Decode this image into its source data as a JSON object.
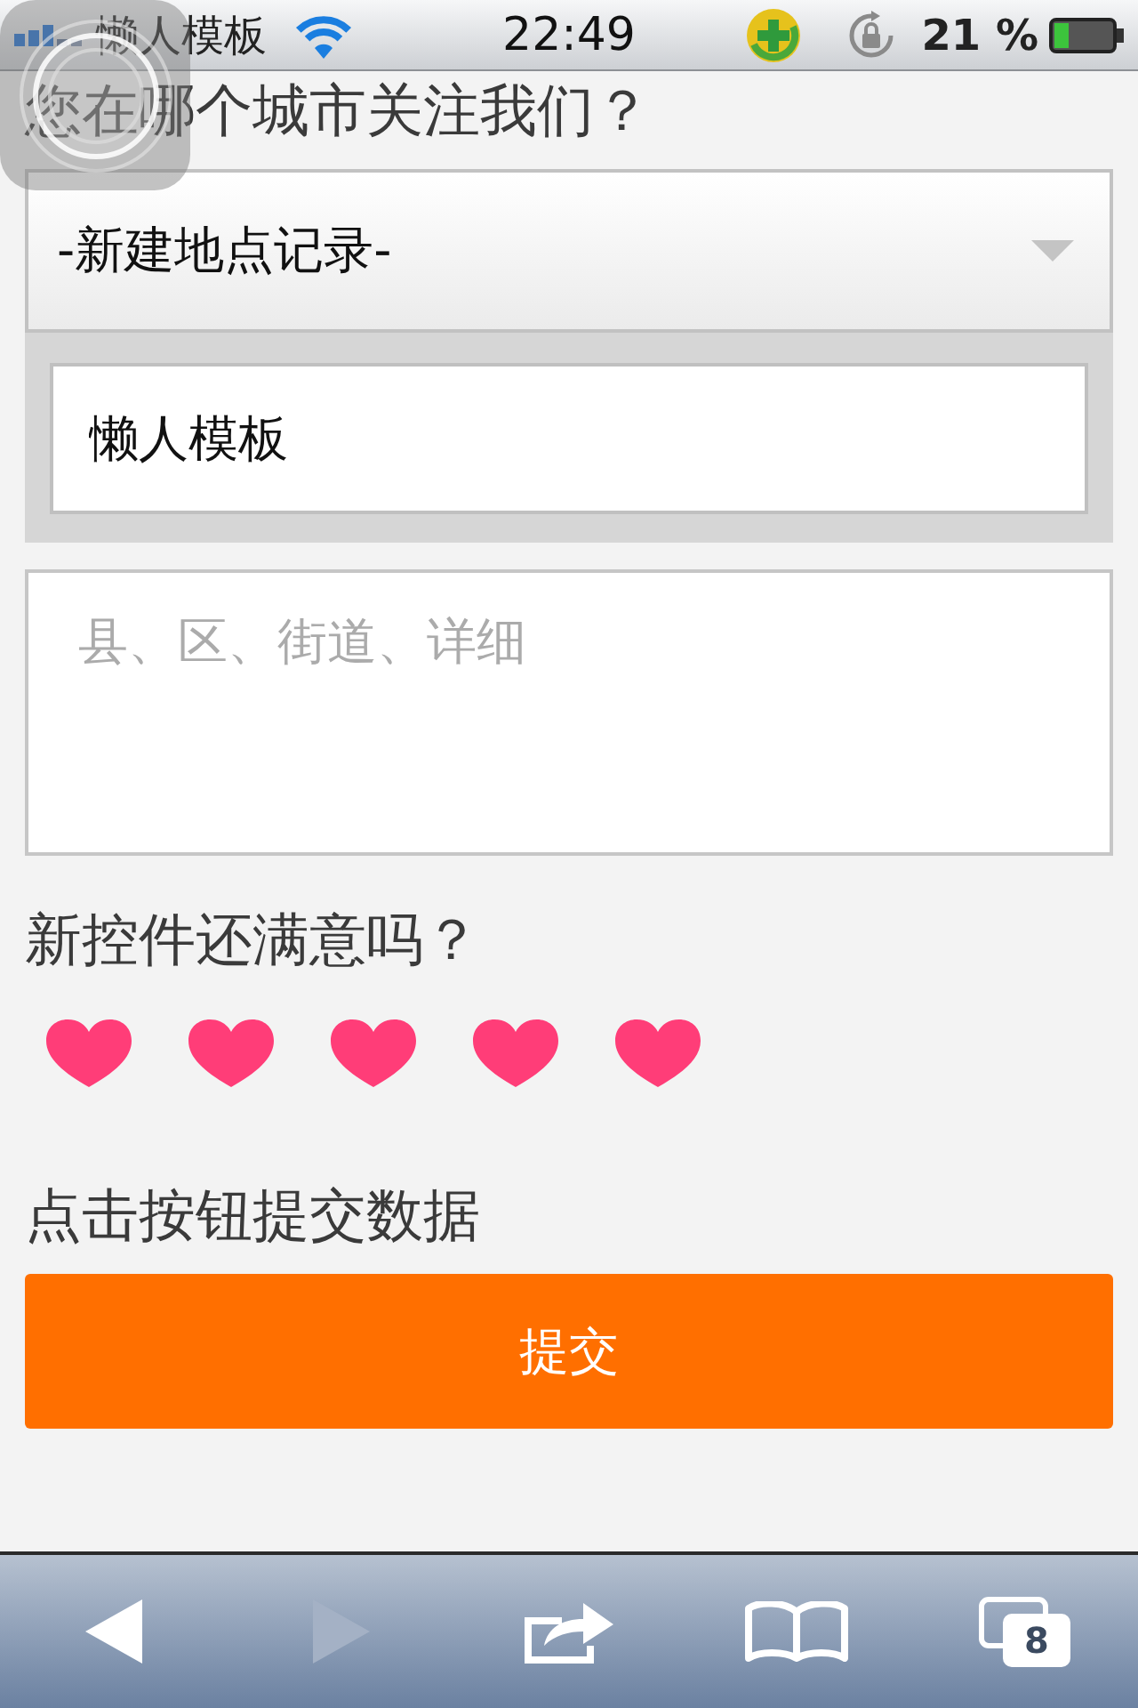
{
  "status_bar": {
    "carrier": "懒人模板",
    "time": "22:49",
    "battery_percent": "21 %"
  },
  "form": {
    "city_question": "您在哪个城市关注我们？",
    "location_select": {
      "value": "-新建地点记录-"
    },
    "name_field": {
      "value": "懒人模板"
    },
    "address_field": {
      "placeholder": "县、区、街道、详细"
    },
    "rating_question": "新控件还满意吗？",
    "rating": {
      "stars": 5
    },
    "submit_prompt": "点击按钮提交数据",
    "submit_button": {
      "label": "提交"
    }
  },
  "toolbar": {
    "buttons": [
      {
        "kind": "back",
        "disabled": false
      },
      {
        "kind": "forward",
        "disabled": true
      },
      {
        "kind": "share",
        "disabled": false
      },
      {
        "kind": "bookmarks",
        "disabled": false
      },
      {
        "kind": "tabs",
        "disabled": false,
        "badge": "8"
      }
    ]
  }
}
